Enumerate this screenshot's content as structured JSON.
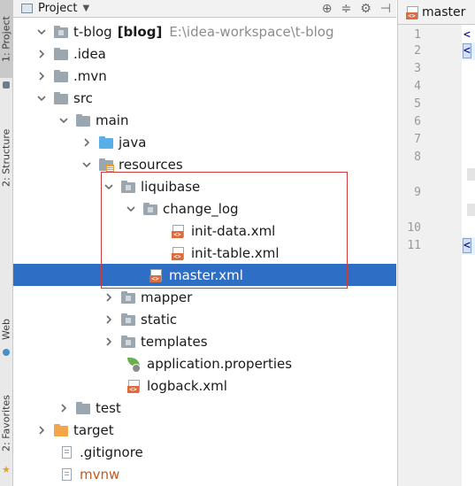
{
  "header": {
    "title": "Project",
    "dropdown_icon": "chevron-down-icon",
    "tools": [
      "target-icon",
      "collapse-icon",
      "gear-icon",
      "hide-icon"
    ]
  },
  "side_tabs": {
    "project": "1: Project",
    "structure": "2: Structure",
    "web": "Web",
    "favorites": "2: Favorites"
  },
  "tree": {
    "root": {
      "name": "t-blog",
      "module": "[blog]",
      "path": "E:\\idea-workspace\\t-blog"
    },
    "items": [
      {
        "label": ".idea"
      },
      {
        "label": ".mvn"
      },
      {
        "label": "src"
      },
      {
        "label": "main"
      },
      {
        "label": "java"
      },
      {
        "label": "resources"
      },
      {
        "label": "liquibase"
      },
      {
        "label": "change_log"
      },
      {
        "label": "init-data.xml"
      },
      {
        "label": "init-table.xml"
      },
      {
        "label": "master.xml"
      },
      {
        "label": "mapper"
      },
      {
        "label": "static"
      },
      {
        "label": "templates"
      },
      {
        "label": "application.properties"
      },
      {
        "label": "logback.xml"
      },
      {
        "label": "test"
      },
      {
        "label": "target"
      },
      {
        "label": ".gitignore"
      },
      {
        "label": "mvnw"
      }
    ],
    "selected": "master.xml"
  },
  "editor": {
    "tab_label": "master",
    "line_numbers": [
      "1",
      "2",
      "3",
      "4",
      "5",
      "6",
      "7",
      "8",
      "9",
      "10",
      "11"
    ],
    "line_fragments": [
      "<",
      "<"
    ]
  },
  "colors": {
    "selection": "#2f6ec5",
    "highlight_box": "#d03a3a",
    "xml_badge": "#e06b3a"
  }
}
